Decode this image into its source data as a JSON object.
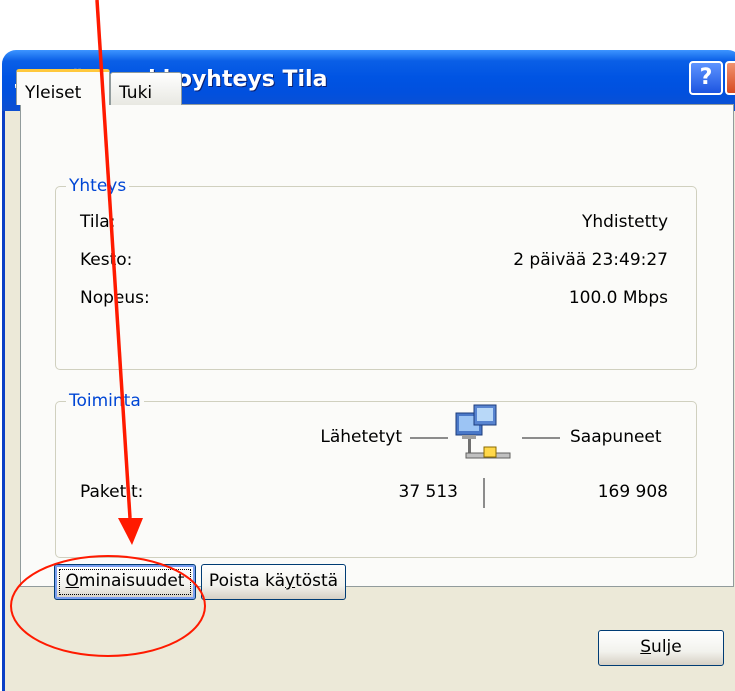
{
  "window": {
    "title": "Lähiverkkoyhteys Tila",
    "help_label": "?",
    "close_label": "✕"
  },
  "tabs": [
    {
      "label": "Yleiset",
      "active": true
    },
    {
      "label": "Tuki",
      "active": false
    }
  ],
  "connection": {
    "legend": "Yhteys",
    "rows": [
      {
        "label": "Tila:",
        "value": "Yhdistetty"
      },
      {
        "label": "Kesto:",
        "value": "2 päivää 23:49:27"
      },
      {
        "label": "Nopeus:",
        "value": "100.0 Mbps"
      }
    ]
  },
  "activity": {
    "legend": "Toiminta",
    "sent_label": "Lähetetyt",
    "received_label": "Saapuneet",
    "packets_label": "Paketit:",
    "sent_value": "37 513",
    "received_value": "169 908"
  },
  "buttons": {
    "properties": "Ominaisuudet",
    "disable": "Poista käytöstä",
    "close": "Sulje"
  },
  "accelerators": {
    "properties": "O",
    "disable": "y",
    "close": "S"
  },
  "colors": {
    "title_bar": "#0054e3",
    "dialog_bg": "#ece9d8",
    "legend_text": "#0046d5",
    "annotation": "#ff1a00"
  },
  "icons": [
    "network-connection-icon",
    "help-icon",
    "close-icon",
    "network-activity-icon"
  ]
}
